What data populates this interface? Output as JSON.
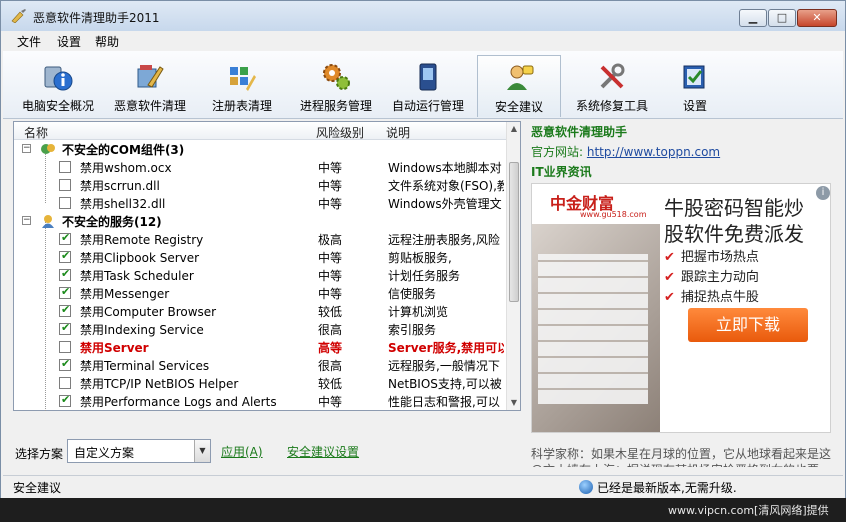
{
  "window": {
    "title": "恶意软件清理助手2011"
  },
  "window_buttons": {
    "minimize": "▁",
    "maximize": "□",
    "close": "✕"
  },
  "menu": [
    "文件",
    "设置",
    "帮助"
  ],
  "toolbar": [
    {
      "label": "电脑安全概况",
      "icon": "shield-info-icon"
    },
    {
      "label": "恶意软件清理",
      "icon": "broom-icon"
    },
    {
      "label": "注册表清理",
      "icon": "registry-icon"
    },
    {
      "label": "进程服务管理",
      "icon": "gears-icon"
    },
    {
      "label": "自动运行管理",
      "icon": "phone-icon"
    },
    {
      "label": "安全建议",
      "icon": "user-advice-icon",
      "active": true
    },
    {
      "label": "系统修复工具",
      "icon": "tools-icon"
    },
    {
      "label": "设置",
      "icon": "settings-check-icon"
    }
  ],
  "table": {
    "columns": [
      "名称",
      "风险级别",
      "说明"
    ],
    "groups": [
      {
        "title": "不安全的COM组件(3)",
        "icon": "com-group-icon",
        "items": [
          {
            "name": "禁用wshom.ocx",
            "level": "中等",
            "desc": "Windows本地脚本对",
            "checked": false
          },
          {
            "name": "禁用scrrun.dll",
            "level": "中等",
            "desc": "文件系统对象(FSO),教",
            "checked": false
          },
          {
            "name": "禁用shell32.dll",
            "level": "中等",
            "desc": "Windows外壳管理文",
            "checked": false
          }
        ]
      },
      {
        "title": "不安全的服务(12)",
        "icon": "service-group-icon",
        "items": [
          {
            "name": "禁用Remote Registry",
            "level": "极高",
            "desc": "远程注册表服务,风险",
            "checked": true
          },
          {
            "name": "禁用Clipbook Server",
            "level": "中等",
            "desc": "剪贴板服务,",
            "checked": true
          },
          {
            "name": "禁用Task Scheduler",
            "level": "中等",
            "desc": "计划任务服务",
            "checked": true
          },
          {
            "name": "禁用Messenger",
            "level": "中等",
            "desc": "信使服务",
            "checked": true
          },
          {
            "name": "禁用Computer Browser",
            "level": "较低",
            "desc": "计算机浏览",
            "checked": true
          },
          {
            "name": "禁用Indexing Service",
            "level": "很高",
            "desc": "索引服务",
            "checked": true
          },
          {
            "name": "禁用Server",
            "level": "高等",
            "desc": "Server服务,禁用可以",
            "checked": false,
            "highlight": true
          },
          {
            "name": "禁用Terminal Services",
            "level": "很高",
            "desc": "远程服务,一般情况下",
            "checked": true
          },
          {
            "name": "禁用TCP/IP NetBIOS Helper",
            "level": "较低",
            "desc": "NetBIOS支持,可以被",
            "checked": false
          },
          {
            "name": "禁用Performance Logs and Alerts",
            "level": "中等",
            "desc": "性能日志和警报,可以",
            "checked": true
          }
        ]
      }
    ]
  },
  "right_panel": {
    "app_name": "恶意软件清理助手",
    "site_label": "官方网站:",
    "site_url": "http://www.toppn.com",
    "news_title": "IT业界资讯",
    "ticker_1": "科学家称：如果木星在月球的位置，它从地球看起来是这",
    "ticker_2": "@文小嫱在上海：据说现在某机场安检严格到女的也要"
  },
  "ad": {
    "logo": "中金财富",
    "logo_url": "www.gu518.com",
    "headline_1": "牛股密码智能炒",
    "headline_2": "股软件免费派发",
    "bullets": [
      "把握市场热点",
      "跟踪主力动向",
      "捕捉热点牛股"
    ],
    "cta": "立即下载",
    "info": "i"
  },
  "bottom": {
    "scheme_label": "选择方案",
    "scheme_value": "自定义方案",
    "apply": "应用(A)",
    "settings_link": "安全建议设置"
  },
  "status": {
    "left": "安全建议",
    "right": "已经是最新版本,无需升级."
  },
  "watermark": "www.vipcn.com[清风网络]提供",
  "colors": {
    "highlight_red": "#d00000",
    "link_green": "#1b7a1b"
  }
}
